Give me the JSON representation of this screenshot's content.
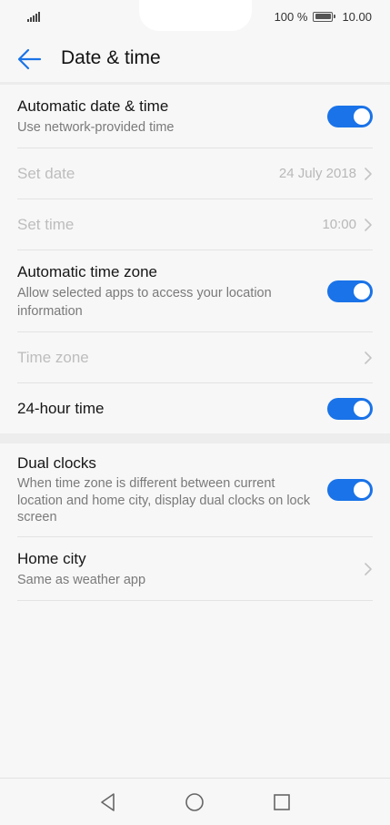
{
  "status_bar": {
    "battery_text": "100 %",
    "time": "10.00",
    "icons": [
      "signal-icon",
      "battery-icon"
    ]
  },
  "header": {
    "title": "Date & time",
    "back_icon": "back-arrow-icon"
  },
  "colors": {
    "accent": "#1a73e8",
    "disabled_text": "#bdbdbd",
    "secondary_text": "#7a7a7a"
  },
  "settings": {
    "automatic_date_time": {
      "title": "Automatic date & time",
      "subtitle": "Use network-provided time",
      "enabled": true
    },
    "set_date": {
      "title": "Set date",
      "value": "24 July 2018"
    },
    "set_time": {
      "title": "Set time",
      "value": "10:00"
    },
    "automatic_time_zone": {
      "title": "Automatic time zone",
      "subtitle": "Allow selected apps to access your location information",
      "enabled": true
    },
    "time_zone": {
      "title": "Time zone"
    },
    "hour_24": {
      "title": "24-hour time",
      "enabled": true
    },
    "dual_clocks": {
      "title": "Dual clocks",
      "subtitle": "When time zone is different between current location and home city, display dual clocks on lock screen",
      "enabled": true
    },
    "home_city": {
      "title": "Home city",
      "subtitle": "Same as weather app"
    }
  },
  "nav_bar": {
    "icons": [
      "back-triangle-icon",
      "home-circle-icon",
      "recents-square-icon"
    ]
  }
}
